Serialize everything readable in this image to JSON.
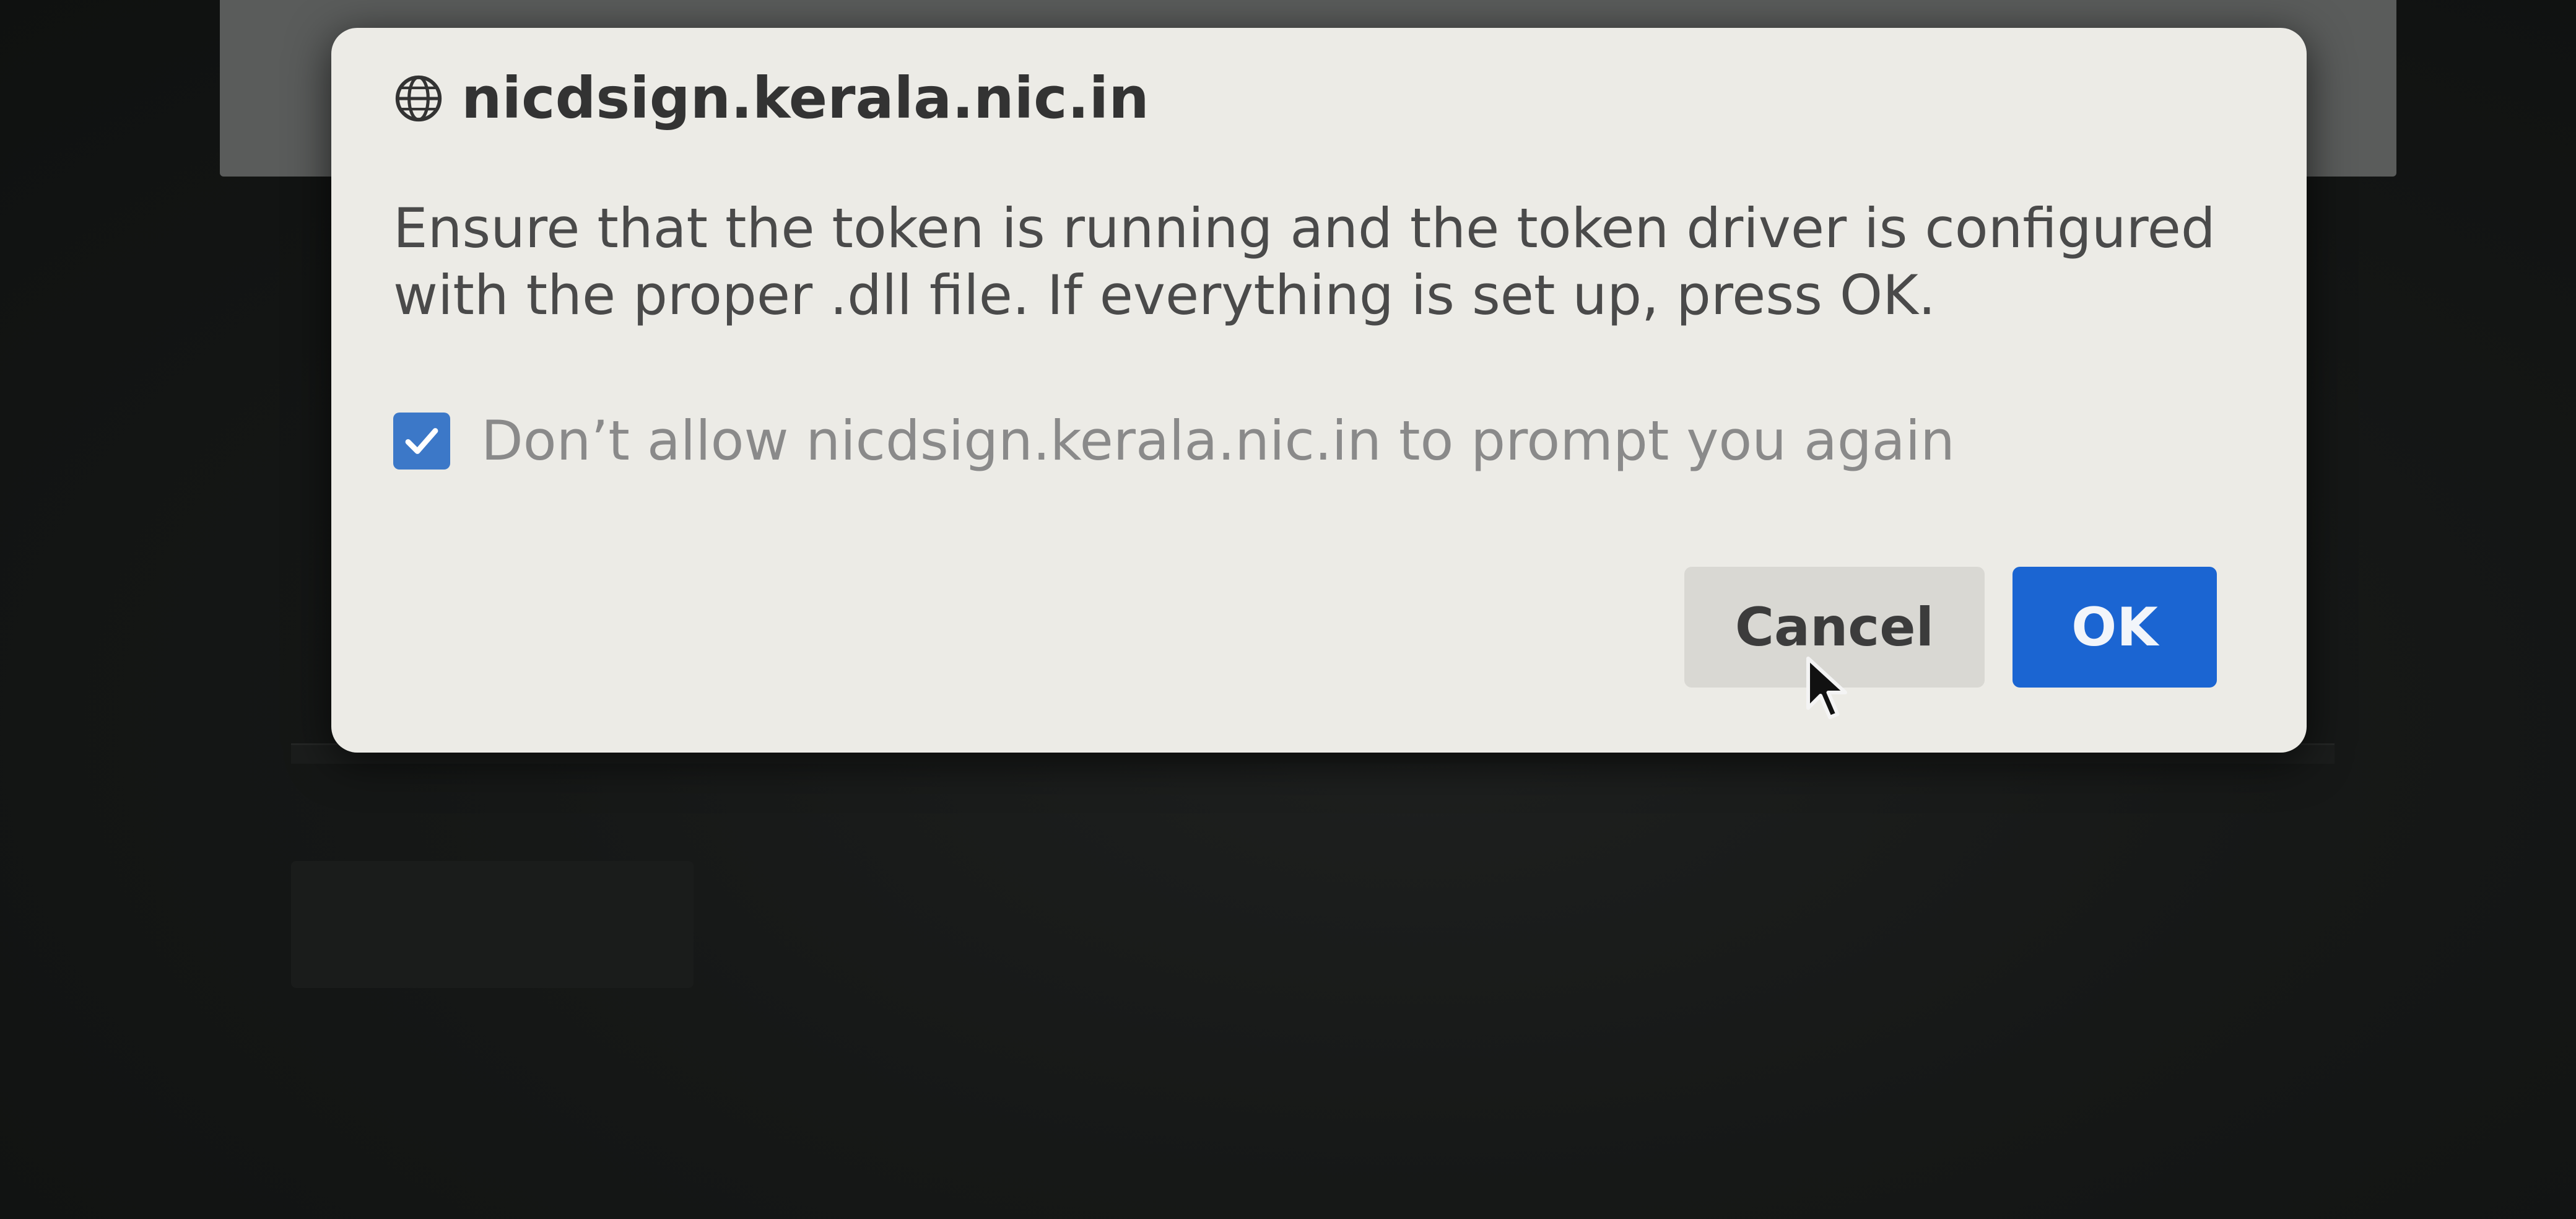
{
  "dialog": {
    "site": "nicdsign.kerala.nic.in",
    "site_icon": "globe-icon",
    "message": "Ensure that the token is running and the token driver is configured with the proper .dll file. If everything is set up, press OK.",
    "checkbox": {
      "checked": true,
      "label": "Don’t allow nicdsign.kerala.nic.in to prompt you again"
    },
    "buttons": {
      "cancel_label": "Cancel",
      "ok_label": "OK"
    }
  },
  "colors": {
    "dialog_background": "#ecebe6",
    "accent": "#1b65d2",
    "checkbox": "#3c78c8",
    "page_background": "#151716"
  }
}
